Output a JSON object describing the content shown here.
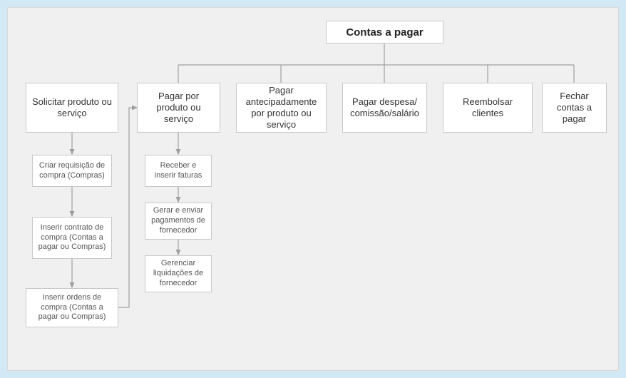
{
  "root": {
    "title": "Contas a pagar"
  },
  "level2": {
    "solicitar": "Solicitar produto ou serviço",
    "pagar_produto": "Pagar por produto ou serviço",
    "pagar_antecipado": "Pagar antecipadamente por produto ou serviço",
    "pagar_despesa": "Pagar despesa/ comissão/salário",
    "reembolsar": "Reembolsar clientes",
    "fechar": "Fechar contas a pagar"
  },
  "col1_steps": {
    "s1": "Criar requisição de compra (Compras)",
    "s2": "Inserir contrato de compra (Contas a pagar ou Compras)",
    "s3": "Inserir ordens de compra (Contas a pagar ou Compras)"
  },
  "col2_steps": {
    "s1": "Receber e inserir faturas",
    "s2": "Gerar e enviar pagamentos de fornecedor",
    "s3": "Gerenciar liquidações de fornecedor"
  }
}
